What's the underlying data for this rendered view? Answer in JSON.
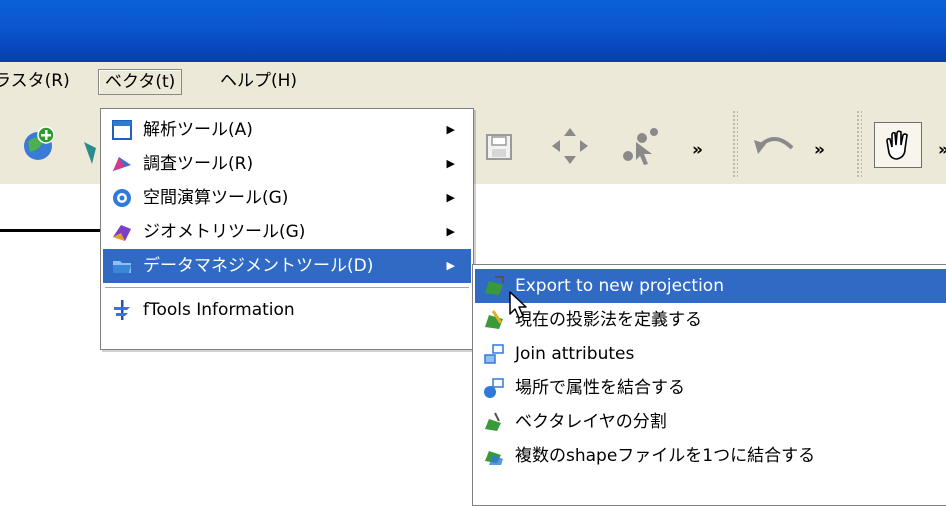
{
  "menubar": {
    "items": [
      {
        "label": "ラスタ(R)"
      },
      {
        "label": "ベクタ(t)"
      },
      {
        "label": "ヘルプ(H)"
      }
    ]
  },
  "toolbar": {
    "chevron": "»"
  },
  "vector_menu": {
    "items": [
      {
        "label": "解析ツール(A)",
        "icon": "analysis-tools-icon",
        "has_submenu": true
      },
      {
        "label": "調査ツール(R)",
        "icon": "research-tools-icon",
        "has_submenu": true
      },
      {
        "label": "空間演算ツール(G)",
        "icon": "geoprocessing-tools-icon",
        "has_submenu": true
      },
      {
        "label": "ジオメトリツール(G)",
        "icon": "geometry-tools-icon",
        "has_submenu": true
      },
      {
        "label": "データマネジメントツール(D)",
        "icon": "data-management-tools-icon",
        "has_submenu": true
      },
      {
        "label": "fTools Information",
        "icon": "ftools-info-icon",
        "has_submenu": false
      }
    ]
  },
  "data_management_submenu": {
    "items": [
      {
        "label": "Export to new projection",
        "icon": "export-projection-icon"
      },
      {
        "label": "現在の投影法を定義する",
        "icon": "define-projection-icon"
      },
      {
        "label": "Join attributes",
        "icon": "join-attributes-icon"
      },
      {
        "label": "場所で属性を結合する",
        "icon": "spatial-join-icon"
      },
      {
        "label": "ベクタレイヤの分割",
        "icon": "split-layer-icon"
      },
      {
        "label": "複数のshapeファイルを1つに結合する",
        "icon": "merge-shapefiles-icon"
      }
    ]
  },
  "colors": {
    "titlebar": "#0a5fd8",
    "chrome": "#ece9d8",
    "highlight": "#316ac5"
  }
}
